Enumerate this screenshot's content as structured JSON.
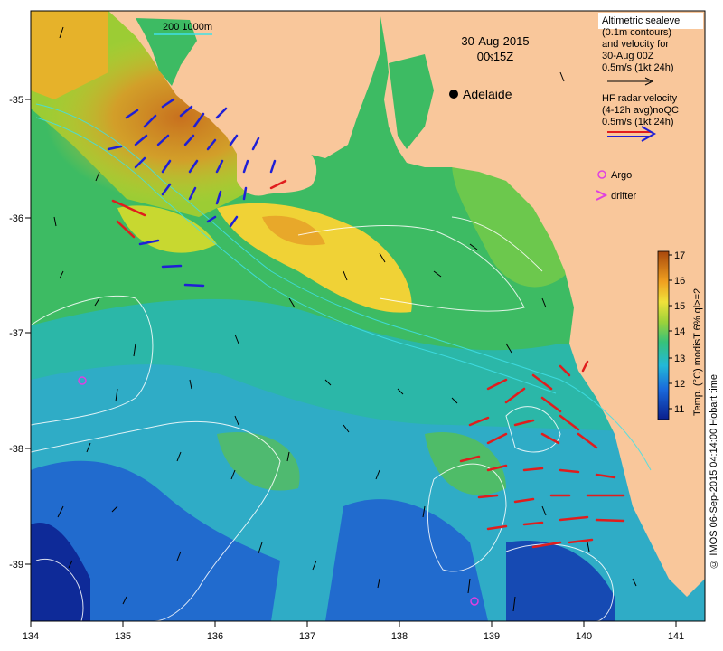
{
  "map": {
    "date_line": "30-Aug-2015",
    "time_line": "00:15Z",
    "scale_label": "200   1000m",
    "city": "Adelaide",
    "credit": "© IMOS 06-Sep-2015 04:14:00 Hobart time"
  },
  "legend": {
    "altimetry_lines": [
      "Altimetric sealevel",
      "(0.1m contours)",
      "and velocity for",
      "30-Aug 00Z",
      "0.5m/s (1kt 24h)"
    ],
    "hf_lines": [
      "HF radar velocity",
      "(4-12h avg)noQC",
      "0.5m/s (1kt 24h)"
    ],
    "argo": "Argo",
    "drifter": "drifter",
    "colorbar_title": "Temp. (°C) modisT 6% ql>=2",
    "colorbar_ticks": [
      "11",
      "12",
      "13",
      "14",
      "15",
      "16",
      "17"
    ],
    "colorbar_range": [
      10.5,
      17.3
    ]
  },
  "axes": {
    "lon_ticks": [
      "134",
      "135",
      "136",
      "137",
      "138",
      "139",
      "140",
      "141"
    ],
    "lat_ticks": [
      "-35",
      "-36",
      "-37",
      "-38",
      "-39"
    ],
    "lon_range": [
      134,
      141.3
    ],
    "lat_range": [
      -39.55,
      -34.35
    ]
  },
  "colors": {
    "land": "#f9c79b",
    "hf_blue": "#1f1fd6",
    "hf_red": "#e01d1d",
    "argo": "#e040e0",
    "contour": "#ffffff",
    "isobath": "#40e0e8"
  },
  "argo_floats": [
    [
      134.6,
      -37.4
    ],
    [
      138.82,
      -39.32
    ]
  ],
  "city_location": [
    138.6,
    -34.93
  ]
}
